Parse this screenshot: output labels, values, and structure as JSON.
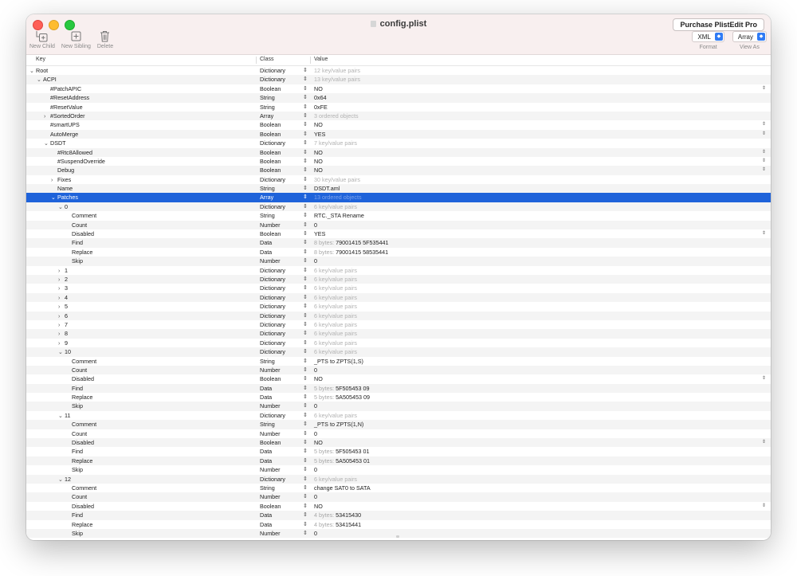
{
  "window": {
    "title": "config.plist",
    "purchase_label": "Purchase PlistEdit Pro"
  },
  "toolbar": {
    "new_child": "New Child",
    "new_sibling": "New Sibling",
    "delete": "Delete",
    "format_value": "XML",
    "format_label": "Format",
    "view_value": "Array",
    "view_label": "View As"
  },
  "columns": {
    "key": "Key",
    "class": "Class",
    "value": "Value"
  },
  "rows": [
    {
      "key": "Root",
      "cls": "Dictionary",
      "value": "12 key/value pairs",
      "depth": 0,
      "disc": "open",
      "muted": true
    },
    {
      "key": "ACPI",
      "cls": "Dictionary",
      "value": "13 key/value pairs",
      "depth": 1,
      "disc": "open",
      "muted": true
    },
    {
      "key": "#PatchAPIC",
      "cls": "Boolean",
      "value": "NO",
      "depth": 2,
      "popup": true
    },
    {
      "key": "#ResetAddress",
      "cls": "String",
      "value": "0x64",
      "depth": 2
    },
    {
      "key": "#ResetValue",
      "cls": "String",
      "value": "0xFE",
      "depth": 2
    },
    {
      "key": "#SortedOrder",
      "cls": "Array",
      "value": "3 ordered objects",
      "depth": 2,
      "disc": "closed",
      "muted": true
    },
    {
      "key": "#smartUPS",
      "cls": "Boolean",
      "value": "NO",
      "depth": 2,
      "popup": true
    },
    {
      "key": "AutoMerge",
      "cls": "Boolean",
      "value": "YES",
      "depth": 2,
      "popup": true
    },
    {
      "key": "DSDT",
      "cls": "Dictionary",
      "value": "7 key/value pairs",
      "depth": 2,
      "disc": "open",
      "muted": true
    },
    {
      "key": "#Rtc8Allowed",
      "cls": "Boolean",
      "value": "NO",
      "depth": 3,
      "popup": true
    },
    {
      "key": "#SuspendOverride",
      "cls": "Boolean",
      "value": "NO",
      "depth": 3,
      "popup": true
    },
    {
      "key": "Debug",
      "cls": "Boolean",
      "value": "NO",
      "depth": 3,
      "popup": true
    },
    {
      "key": "Fixes",
      "cls": "Dictionary",
      "value": "30 key/value pairs",
      "depth": 3,
      "disc": "closed",
      "muted": true
    },
    {
      "key": "Name",
      "cls": "String",
      "value": "DSDT.aml",
      "depth": 3
    },
    {
      "key": "Patches",
      "cls": "Array",
      "value": "13 ordered objects",
      "depth": 3,
      "disc": "open",
      "muted": true,
      "selected": true
    },
    {
      "key": "0",
      "cls": "Dictionary",
      "value": "6 key/value pairs",
      "depth": 4,
      "disc": "open",
      "muted": true
    },
    {
      "key": "Comment",
      "cls": "String",
      "value": "RTC._STA Rename",
      "depth": 5
    },
    {
      "key": "Count",
      "cls": "Number",
      "value": "0",
      "depth": 5
    },
    {
      "key": "Disabled",
      "cls": "Boolean",
      "value": "YES",
      "depth": 5,
      "popup": true
    },
    {
      "key": "Find",
      "cls": "Data",
      "pre": "8 bytes:",
      "value": "79001415 5F535441",
      "depth": 5
    },
    {
      "key": "Replace",
      "cls": "Data",
      "pre": "8 bytes:",
      "value": "79001415 58535441",
      "depth": 5
    },
    {
      "key": "Skip",
      "cls": "Number",
      "value": "0",
      "depth": 5
    },
    {
      "key": "1",
      "cls": "Dictionary",
      "value": "6 key/value pairs",
      "depth": 4,
      "disc": "closed",
      "muted": true
    },
    {
      "key": "2",
      "cls": "Dictionary",
      "value": "6 key/value pairs",
      "depth": 4,
      "disc": "closed",
      "muted": true
    },
    {
      "key": "3",
      "cls": "Dictionary",
      "value": "6 key/value pairs",
      "depth": 4,
      "disc": "closed",
      "muted": true
    },
    {
      "key": "4",
      "cls": "Dictionary",
      "value": "6 key/value pairs",
      "depth": 4,
      "disc": "closed",
      "muted": true
    },
    {
      "key": "5",
      "cls": "Dictionary",
      "value": "6 key/value pairs",
      "depth": 4,
      "disc": "closed",
      "muted": true
    },
    {
      "key": "6",
      "cls": "Dictionary",
      "value": "6 key/value pairs",
      "depth": 4,
      "disc": "closed",
      "muted": true
    },
    {
      "key": "7",
      "cls": "Dictionary",
      "value": "6 key/value pairs",
      "depth": 4,
      "disc": "closed",
      "muted": true
    },
    {
      "key": "8",
      "cls": "Dictionary",
      "value": "6 key/value pairs",
      "depth": 4,
      "disc": "closed",
      "muted": true
    },
    {
      "key": "9",
      "cls": "Dictionary",
      "value": "6 key/value pairs",
      "depth": 4,
      "disc": "closed",
      "muted": true
    },
    {
      "key": "10",
      "cls": "Dictionary",
      "value": "6 key/value pairs",
      "depth": 4,
      "disc": "open",
      "muted": true
    },
    {
      "key": "Comment",
      "cls": "String",
      "value": "_PTS to ZPTS(1,S)",
      "depth": 5
    },
    {
      "key": "Count",
      "cls": "Number",
      "value": "0",
      "depth": 5
    },
    {
      "key": "Disabled",
      "cls": "Boolean",
      "value": "NO",
      "depth": 5,
      "popup": true
    },
    {
      "key": "Find",
      "cls": "Data",
      "pre": "5 bytes:",
      "value": "5F505453 09",
      "depth": 5
    },
    {
      "key": "Replace",
      "cls": "Data",
      "pre": "5 bytes:",
      "value": "5A505453 09",
      "depth": 5
    },
    {
      "key": "Skip",
      "cls": "Number",
      "value": "0",
      "depth": 5
    },
    {
      "key": "11",
      "cls": "Dictionary",
      "value": "6 key/value pairs",
      "depth": 4,
      "disc": "open",
      "muted": true
    },
    {
      "key": "Comment",
      "cls": "String",
      "value": "_PTS to ZPTS(1,N)",
      "depth": 5
    },
    {
      "key": "Count",
      "cls": "Number",
      "value": "0",
      "depth": 5
    },
    {
      "key": "Disabled",
      "cls": "Boolean",
      "value": "NO",
      "depth": 5,
      "popup": true
    },
    {
      "key": "Find",
      "cls": "Data",
      "pre": "5 bytes:",
      "value": "5F505453 01",
      "depth": 5
    },
    {
      "key": "Replace",
      "cls": "Data",
      "pre": "5 bytes:",
      "value": "5A505453 01",
      "depth": 5
    },
    {
      "key": "Skip",
      "cls": "Number",
      "value": "0",
      "depth": 5
    },
    {
      "key": "12",
      "cls": "Dictionary",
      "value": "6 key/value pairs",
      "depth": 4,
      "disc": "open",
      "muted": true
    },
    {
      "key": "Comment",
      "cls": "String",
      "value": "change SAT0 to SATA",
      "depth": 5
    },
    {
      "key": "Count",
      "cls": "Number",
      "value": "0",
      "depth": 5
    },
    {
      "key": "Disabled",
      "cls": "Boolean",
      "value": "NO",
      "depth": 5,
      "popup": true
    },
    {
      "key": "Find",
      "cls": "Data",
      "pre": "4 bytes:",
      "value": "53415430",
      "depth": 5
    },
    {
      "key": "Replace",
      "cls": "Data",
      "pre": "4 bytes:",
      "value": "53415441",
      "depth": 5
    },
    {
      "key": "Skip",
      "cls": "Number",
      "value": "0",
      "depth": 5
    }
  ]
}
